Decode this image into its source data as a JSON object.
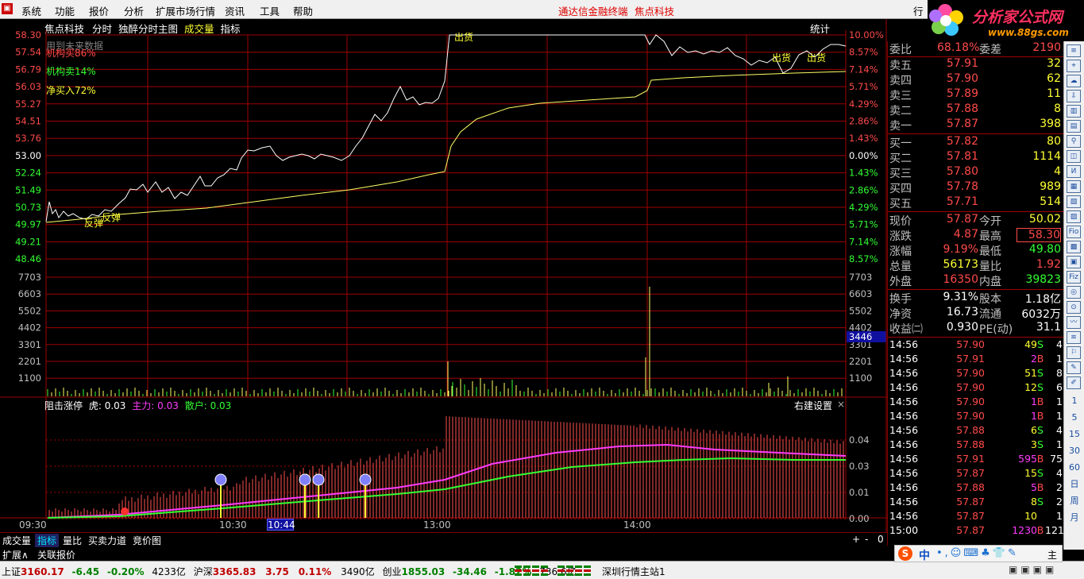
{
  "menu": {
    "items": [
      "系统",
      "功能",
      "报价",
      "分析",
      "扩展市场行情",
      "资讯",
      "工具",
      "帮助"
    ],
    "center_title": "通达信金融终端",
    "stock_title": "焦点科技",
    "right_cut": "行"
  },
  "logo": {
    "brand": "分析家公式网",
    "url": "www.88gs.com"
  },
  "chart_header": {
    "name": "焦点科技",
    "items": [
      "分时",
      "独醉分时主图",
      "成交量",
      "指标"
    ],
    "stat": "统计"
  },
  "overlay_text": {
    "future": "用到未来数据",
    "buy": "机构买86%",
    "sell": "机构卖14%",
    "net": "净买入72%"
  },
  "price_axis_left": [
    "58.30",
    "57.54",
    "56.79",
    "56.03",
    "55.27",
    "54.51",
    "53.76",
    "53.00",
    "52.24",
    "51.49",
    "50.73",
    "49.97",
    "49.21",
    "48.46"
  ],
  "pct_axis_right": [
    "10.00%",
    "8.57%",
    "7.14%",
    "5.71%",
    "4.29%",
    "2.86%",
    "1.43%",
    "0.00%",
    "1.43%",
    "2.86%",
    "4.29%",
    "5.71%",
    "7.14%",
    "8.57%"
  ],
  "vol_axis_left": [
    "7703",
    "6603",
    "5502",
    "4402",
    "3301",
    "2201",
    "1100"
  ],
  "vol_axis_right": [
    "7703",
    "6603",
    "5502",
    "4402",
    "3301",
    "2201",
    "1100"
  ],
  "vol_highlight": "3446",
  "annotations": {
    "rebound1": "反弹",
    "rebound2": "反弹",
    "out1": "出货",
    "out2": "出货",
    "out3": "出货"
  },
  "indicator": {
    "name": "阻击涨停",
    "tiger_label": "虎:",
    "tiger_val": "0.03",
    "main_label": "主力:",
    "main_val": "0.03",
    "retail_label": "散户:",
    "retail_val": "0.03",
    "settings": "右建设置",
    "close": "×",
    "axis": [
      "0.04",
      "0.03",
      "0.01",
      "0.00"
    ]
  },
  "time_axis": [
    "09:30",
    "10:30",
    "13:00",
    "14:00"
  ],
  "time_cursor": "10:44",
  "bottom_tabs": [
    "成交量",
    "指标",
    "量比",
    "买卖力道",
    "竞价图"
  ],
  "bottom_tabs2": [
    "扩展∧",
    "关联报价"
  ],
  "bottom_ctrl": [
    "+",
    "-",
    "0"
  ],
  "order_book": {
    "weibi": {
      "label": "委比",
      "val": "68.18%",
      "label2": "委差",
      "val2": "2190"
    },
    "sells": [
      {
        "label": "卖五",
        "price": "57.91",
        "vol": "32"
      },
      {
        "label": "卖四",
        "price": "57.90",
        "vol": "62"
      },
      {
        "label": "卖三",
        "price": "57.89",
        "vol": "11"
      },
      {
        "label": "卖二",
        "price": "57.88",
        "vol": "8"
      },
      {
        "label": "卖一",
        "price": "57.87",
        "vol": "398"
      }
    ],
    "buys": [
      {
        "label": "买一",
        "price": "57.82",
        "vol": "80"
      },
      {
        "label": "买二",
        "price": "57.81",
        "vol": "1114"
      },
      {
        "label": "买三",
        "price": "57.80",
        "vol": "4"
      },
      {
        "label": "买四",
        "price": "57.78",
        "vol": "989"
      },
      {
        "label": "买五",
        "price": "57.71",
        "vol": "514"
      }
    ]
  },
  "quote": [
    {
      "l1": "现价",
      "v1": "57.87",
      "l2": "今开",
      "v2": "50.02"
    },
    {
      "l1": "涨跌",
      "v1": "4.87",
      "l2": "最高",
      "v2": "58.30"
    },
    {
      "l1": "涨幅",
      "v1": "9.19%",
      "l2": "最低",
      "v2": "49.80"
    },
    {
      "l1": "总量",
      "v1": "56173",
      "l2": "量比",
      "v2": "1.92"
    },
    {
      "l1": "外盘",
      "v1": "16350",
      "l2": "内盘",
      "v2": "39823"
    }
  ],
  "stats": [
    {
      "l1": "换手",
      "v1": "9.31%",
      "l2": "股本",
      "v2": "1.18亿"
    },
    {
      "l1": "净资",
      "v1": "16.73",
      "l2": "流通",
      "v2": "6032万"
    },
    {
      "l1": "收益㈡",
      "v1": "0.930",
      "l2": "PE(动)",
      "v2": "31.1"
    }
  ],
  "ticks": [
    {
      "t": "14:56",
      "p": "57.90",
      "v": "49",
      "bs": "S",
      "n": "4"
    },
    {
      "t": "14:56",
      "p": "57.91",
      "v": "2",
      "bs": "B",
      "n": "1"
    },
    {
      "t": "14:56",
      "p": "57.90",
      "v": "51",
      "bs": "S",
      "n": "8"
    },
    {
      "t": "14:56",
      "p": "57.90",
      "v": "12",
      "bs": "S",
      "n": "6"
    },
    {
      "t": "14:56",
      "p": "57.90",
      "v": "1",
      "bs": "B",
      "n": "1"
    },
    {
      "t": "14:56",
      "p": "57.90",
      "v": "1",
      "bs": "B",
      "n": "1"
    },
    {
      "t": "14:56",
      "p": "57.88",
      "v": "6",
      "bs": "S",
      "n": "4"
    },
    {
      "t": "14:56",
      "p": "57.88",
      "v": "3",
      "bs": "S",
      "n": "1"
    },
    {
      "t": "14:56",
      "p": "57.91",
      "v": "595",
      "bs": "B",
      "n": "75"
    },
    {
      "t": "14:56",
      "p": "57.87",
      "v": "15",
      "bs": "S",
      "n": "4"
    },
    {
      "t": "14:56",
      "p": "57.88",
      "v": "5",
      "bs": "B",
      "n": "2"
    },
    {
      "t": "14:56",
      "p": "57.87",
      "v": "8",
      "bs": "S",
      "n": "2"
    },
    {
      "t": "14:56",
      "p": "57.87",
      "v": "10",
      "bs": "",
      "n": "1"
    },
    {
      "t": "15:00",
      "p": "57.87",
      "v": "1230",
      "bs": "B",
      "n": "121"
    }
  ],
  "right_toolbar": [
    "1",
    "5",
    "15",
    "30",
    "60",
    "日",
    "周",
    "月"
  ],
  "status": {
    "sh_label": "上证",
    "sh_val": "3160.17",
    "sh_chg": "-6.45",
    "sh_pct": "-0.20%",
    "sh_amt": "4233亿",
    "sz_label": "沪深",
    "sz_val": "3365.83",
    "sz_chg": "3.75",
    "sz_pct": "0.11%",
    "sz_amt": "3490亿",
    "cy_label": "创业",
    "cy_val": "1855.03",
    "cy_chg": "-34.46",
    "cy_pct": "-1.82%",
    "cy_amt": "736.6亿",
    "server": "深圳行情主站1"
  },
  "ime": {
    "mode": "中",
    "tab": "主"
  }
}
